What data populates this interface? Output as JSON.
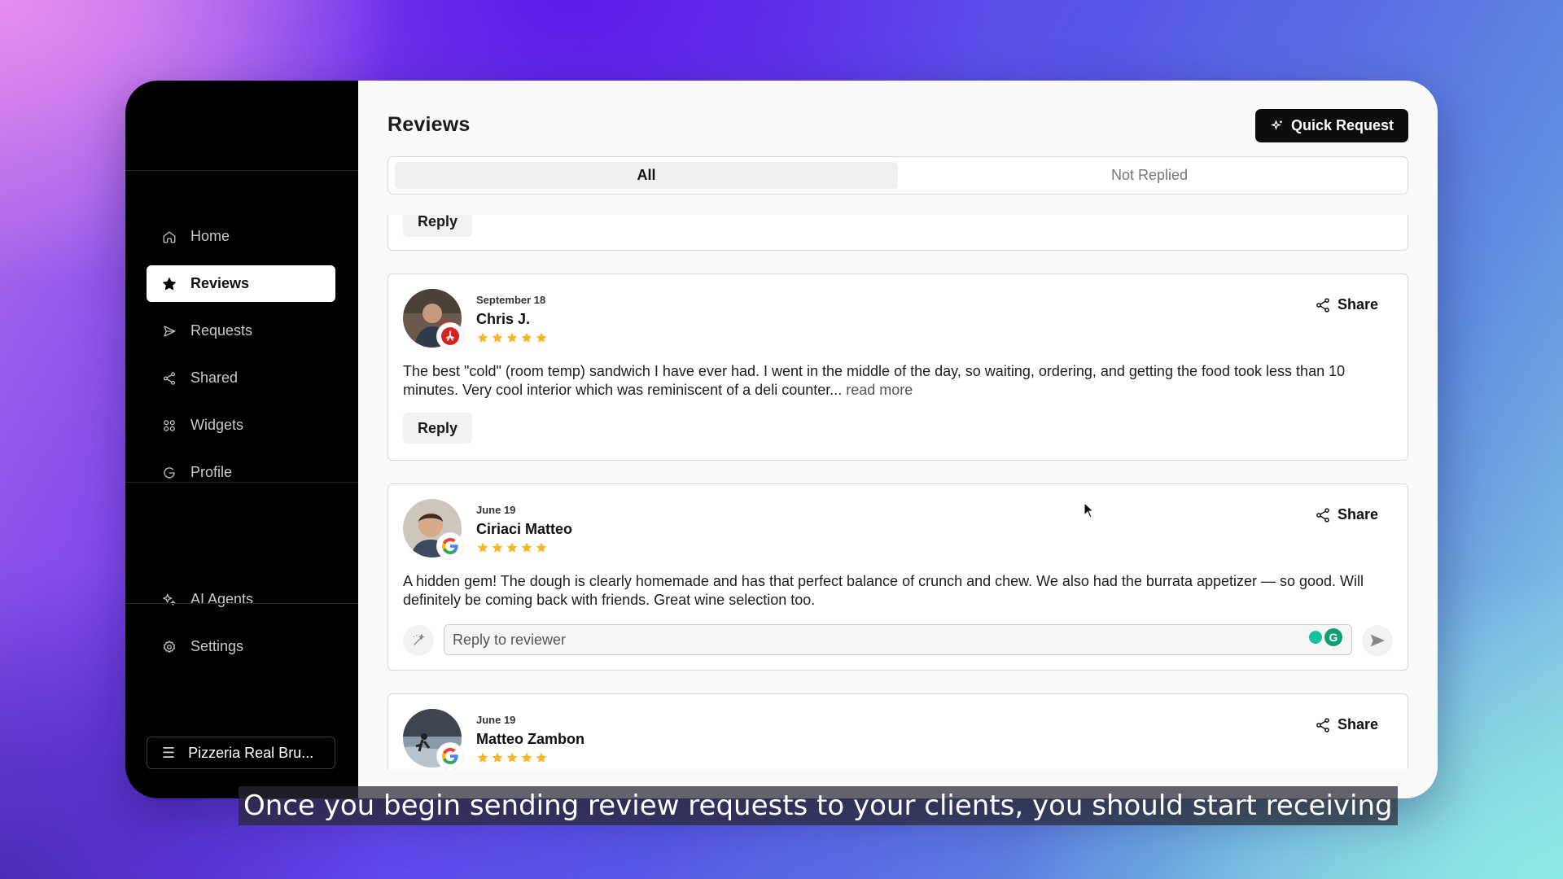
{
  "sidebar": {
    "nav": [
      {
        "label": "Home",
        "icon": "home-icon"
      },
      {
        "label": "Reviews",
        "icon": "star-icon",
        "active": true
      },
      {
        "label": "Requests",
        "icon": "send-icon"
      },
      {
        "label": "Shared",
        "icon": "share-icon"
      },
      {
        "label": "Widgets",
        "icon": "widgets-icon"
      },
      {
        "label": "Profile",
        "icon": "google-icon"
      }
    ],
    "nav2": [
      {
        "label": "AI Agents",
        "icon": "sparkle-icon"
      },
      {
        "label": "Settings",
        "icon": "gear-icon"
      }
    ],
    "business": "Pizzeria Real Bru..."
  },
  "header": {
    "title": "Reviews",
    "quick_request": "Quick Request"
  },
  "tabs": [
    {
      "label": "All",
      "active": true
    },
    {
      "label": "Not Replied",
      "active": false
    }
  ],
  "reviews": [
    {
      "reply_label": "Reply"
    },
    {
      "date": "September 18",
      "name": "Chris J.",
      "rating": 5,
      "source": "yelp",
      "text": "The best \"cold\" (room temp) sandwich I have ever had. I went in the middle of the day, so waiting, ordering, and getting the food took less than 10 minutes. Very cool interior which was reminiscent of a deli counter...",
      "read_more": "read more",
      "share": "Share",
      "reply_label": "Reply"
    },
    {
      "date": "June 19",
      "name": "Ciriaci Matteo",
      "rating": 5,
      "source": "google",
      "text": "A hidden gem! The dough is clearly homemade and has that perfect balance of crunch and chew. We also had the burrata appetizer — so good. Will definitely be coming back with friends. Great wine selection too.",
      "share": "Share",
      "reply_placeholder": "Reply to reviewer"
    },
    {
      "date": "June 19",
      "name": "Matteo Zambon",
      "rating": 5,
      "source": "google",
      "share": "Share"
    }
  ],
  "caption": "Once you begin sending review requests to your clients, you should start receiving",
  "colors": {
    "star": "#f7b528",
    "yelp": "#d32323",
    "accent": "#0d0d0d"
  }
}
